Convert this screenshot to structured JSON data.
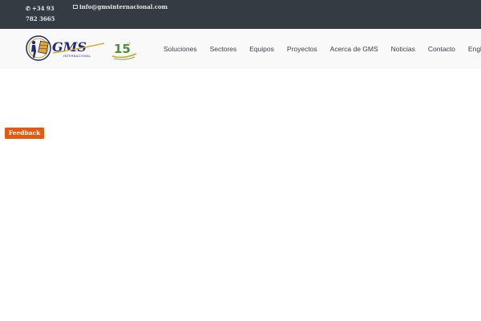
{
  "topbar": {
    "phone": "+34 93 782 3665",
    "email": "info@gmsinternacional.com",
    "phone_icon": "phone-icon",
    "email_icon": "envelope-icon"
  },
  "logo": {
    "brand": "GMS",
    "brand_sub": "INTERNACIONAL",
    "anniversary": "15"
  },
  "nav": {
    "items": [
      {
        "label": "Soluciones"
      },
      {
        "label": "Sectores"
      },
      {
        "label": "Equipos"
      },
      {
        "label": "Proyectos"
      },
      {
        "label": "Acerca de GMS"
      },
      {
        "label": "Noticias"
      },
      {
        "label": "Contacto"
      },
      {
        "label": "English"
      }
    ]
  },
  "feedback": {
    "label": "Feedback"
  },
  "colors": {
    "topbar_bg": "#353b42",
    "header_bg": "#f9f9f9",
    "feedback_bg": "#e8580c",
    "brand_blue": "#1f2b7a",
    "brand_gold": "#d8a21c"
  }
}
